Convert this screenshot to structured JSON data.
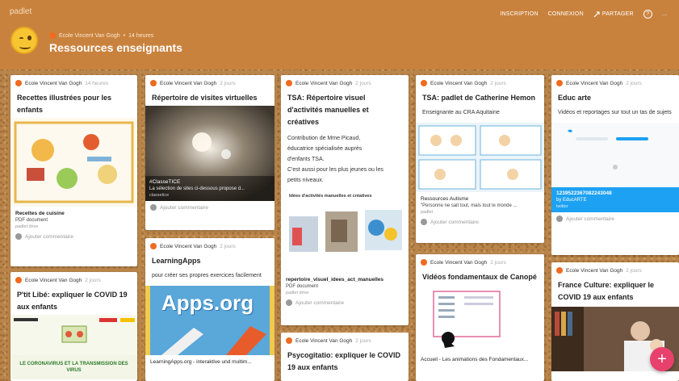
{
  "app": {
    "brand": "padlet"
  },
  "toolbar": {
    "signup": "INSCRIPTION",
    "login": "CONNEXION",
    "share": "PARTAGER",
    "help_icon": "?",
    "more_icon": "…"
  },
  "header": {
    "author": "Ecole Vincent Van Gogh",
    "time": "14 heures",
    "title": "Ressources enseignants"
  },
  "cards": {
    "c1": {
      "author": "Ecole Vincent Van Gogh",
      "time": "14 heures",
      "title": "Recettes illustrées pour les enfants",
      "attach_title": "Recettes de cuisine",
      "attach_sub": "PDF document",
      "attach_src": "padlet drive",
      "comment": "Ajouter commentaire"
    },
    "c2": {
      "author": "Ecole Vincent Van Gogh",
      "time": "2 jours",
      "title": "P'tit Libé: expliquer le COVID 19 aux enfants",
      "img_text": "LE CORONAVIRUS ET LA TRANSMISSION DES VIRUS"
    },
    "c3": {
      "author": "Ecole Vincent Van Gogh",
      "time": "2 jours",
      "title": "Répertoire de visites virtuelles",
      "img_title": "#ClasseTICE",
      "img_desc": "La sélection de sites ci-dessous propose d...",
      "img_src": "classetice",
      "comment": "Ajouter commentaire"
    },
    "c4": {
      "author": "Ecole Vincent Van Gogh",
      "time": "2 jours",
      "title": "LearningApps",
      "text": "pour créer ses propres exercices facilement",
      "logo": "Apps.org",
      "attach_title": "LearningApps.org - interaktive und multim..."
    },
    "c5": {
      "author": "Ecole Vincent Van Gogh",
      "time": "2 jours",
      "title": "TSA: Répertoire visuel d'activités manuelles et créatives",
      "text1": "Contribution de Mme Picaud,",
      "text2": "éducatrice spécialisée auprès",
      "text3": "d'enfants TSA.",
      "text4": "C'est aussi pour les plus jeunes ou les",
      "text5": "petits niveaux.",
      "img_caption": "Idées d'activités manuelles et créatives",
      "attach_title": "repertoire_visuel_idees_act_manuelles",
      "attach_sub": "PDF document",
      "attach_src": "padlet drive",
      "comment": "Ajouter commentaire"
    },
    "c6": {
      "author": "Ecole Vincent Van Gogh",
      "time": "2 jours",
      "title": "Psycogitatio: expliquer le COVID 19 aux enfants"
    },
    "c7": {
      "author": "Ecole Vincent Van Gogh",
      "time": "2 jours",
      "title": "TSA: padlet de Catherine Hemon",
      "text": "Enseignante au CRA Aquitaine",
      "attach_title": "Ressources Autisme",
      "attach_sub": "\"Personne ne sait tout, mais tout le monde ...",
      "attach_src": "padlet",
      "comment": "Ajouter commentaire"
    },
    "c8": {
      "author": "Ecole Vincent Van Gogh",
      "time": "2 jours",
      "title": "Vidéos fondamentaux de Canopé",
      "attach_title": "Accueil - Les animations des Fondamentaux..."
    },
    "c9": {
      "author": "Ecole Vincent Van Gogh",
      "time": "2 jours",
      "title": "Educ arte",
      "text": "Vidéos et reportages sur tout un tas de sujets",
      "tweet_id": "1239522367082243048",
      "tweet_by": "by EducARTE",
      "tweet_src": "twitter",
      "comment": "Ajouter commentaire"
    },
    "c10": {
      "author": "Ecole Vincent Van Gogh",
      "time": "2 jours",
      "title": "France Culture: expliquer le COVID 19 aux enfants"
    }
  },
  "fab": "+"
}
